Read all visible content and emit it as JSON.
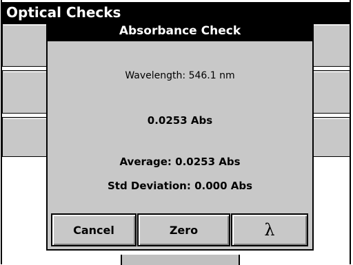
{
  "screen": {
    "title": "Optical Checks"
  },
  "dialog": {
    "title": "Absorbance Check",
    "wavelength": "Wavelength: 546.1 nm",
    "reading": "0.0253 Abs",
    "average": "Average: 0.0253 Abs",
    "std_deviation": "Std Deviation: 0.000 Abs",
    "buttons": {
      "cancel": "Cancel",
      "zero": "Zero",
      "lambda": "λ"
    }
  },
  "colors": {
    "title_bar": "#000000",
    "panel": "#c8c8c8",
    "text": "#000000",
    "title_text": "#ffffff"
  }
}
